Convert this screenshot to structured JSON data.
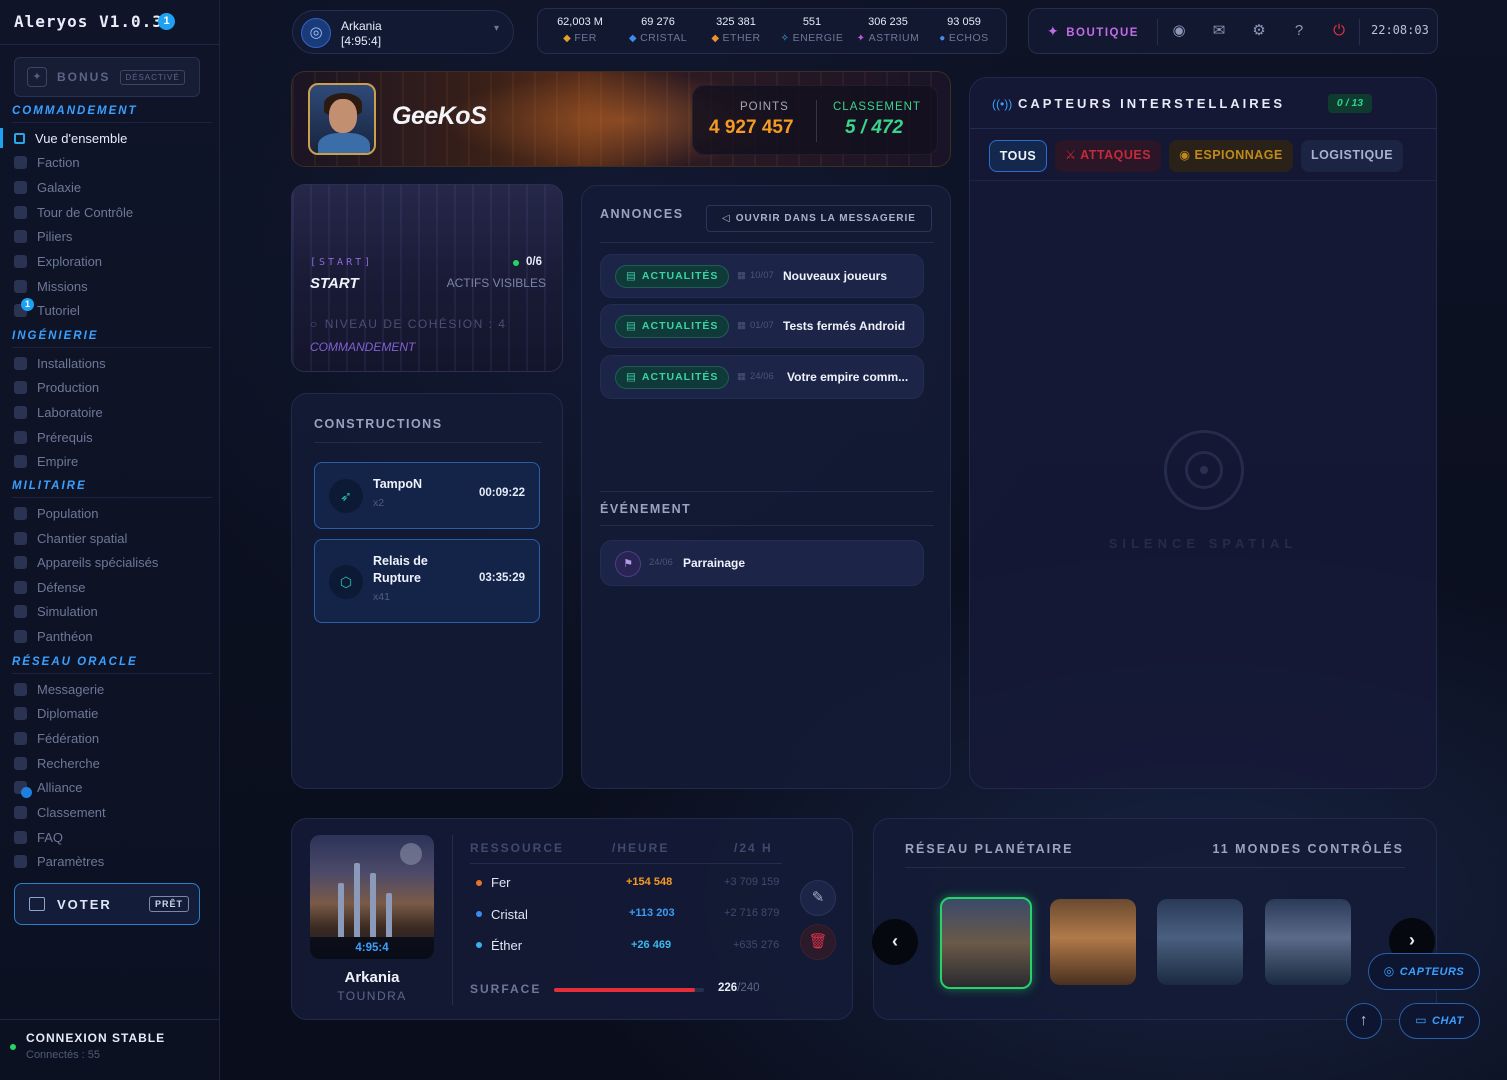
{
  "app": {
    "title": "Aleryos V1.0.36",
    "badge": "1"
  },
  "bonus": {
    "label": "BONUS",
    "status": "DÉSACTIVÉ"
  },
  "sidebar": {
    "sections": [
      {
        "title": "COMMANDEMENT"
      },
      {
        "title": "INGÉNIERIE"
      },
      {
        "title": "MILITAIRE"
      },
      {
        "title": "RÉSEAU ORACLE"
      }
    ],
    "items": [
      {
        "label": "Vue d'ensemble"
      },
      {
        "label": "Faction"
      },
      {
        "label": "Galaxie"
      },
      {
        "label": "Tour de Contrôle"
      },
      {
        "label": "Piliers"
      },
      {
        "label": "Exploration"
      },
      {
        "label": "Missions"
      },
      {
        "label": "Tutoriel"
      },
      {
        "label": "Installations"
      },
      {
        "label": "Production"
      },
      {
        "label": "Laboratoire"
      },
      {
        "label": "Prérequis"
      },
      {
        "label": "Empire"
      },
      {
        "label": "Population"
      },
      {
        "label": "Chantier spatial"
      },
      {
        "label": "Appareils spécialisés"
      },
      {
        "label": "Défense"
      },
      {
        "label": "Simulation"
      },
      {
        "label": "Panthéon"
      },
      {
        "label": "Messagerie"
      },
      {
        "label": "Diplomatie"
      },
      {
        "label": "Fédération"
      },
      {
        "label": "Recherche"
      },
      {
        "label": "Alliance"
      },
      {
        "label": "Classement"
      },
      {
        "label": "FAQ"
      },
      {
        "label": "Paramètres"
      }
    ],
    "tutoriel_badge": "1",
    "vote": {
      "label": "VOTER",
      "status": "PRÊT"
    },
    "connection": {
      "title": "CONNEXION STABLE",
      "sub": "Connectés : 55"
    }
  },
  "planet_selector": {
    "name": "Arkania",
    "coords": "[4:95:4]"
  },
  "resources": [
    {
      "value": "62,003 M",
      "label": "FER",
      "icon": "iron-icon",
      "color": "#e3a02a"
    },
    {
      "value": "69 276",
      "label": "CRISTAL",
      "icon": "crystal-icon",
      "color": "#3a8cf0"
    },
    {
      "value": "325 381",
      "label": "ETHER",
      "icon": "ether-icon",
      "color": "#e8942a"
    },
    {
      "value": "551",
      "label": "ENERGIE",
      "icon": "energy-icon",
      "color": "#3ab0f0"
    },
    {
      "value": "306 235",
      "label": "ASTRIUM",
      "icon": "astrium-icon",
      "color": "#c05ad8"
    },
    {
      "value": "93 059",
      "label": "ECHOS",
      "icon": "echos-icon",
      "color": "#4a8ae8"
    }
  ],
  "topbar": {
    "shop_label": "BOUTIQUE",
    "clock": "22:08:03"
  },
  "profile": {
    "username": "GeeKoS",
    "points_label": "POINTS",
    "points": "4 927 457",
    "rank_label": "CLASSEMENT",
    "rank": "5 / 472"
  },
  "start_card": {
    "tag": "[START]",
    "title": "START",
    "progress": "0/6",
    "actifs": "ACTIFS VISIBLES",
    "level": "NIVEAU DE COHÉSION : 4",
    "category": "COMMANDEMENT"
  },
  "constructions": {
    "title": "CONSTRUCTIONS",
    "jobs": [
      {
        "name": "TampoN",
        "qty": "x2",
        "time": "00:09:22",
        "icon": "rocket-icon"
      },
      {
        "name": "Relais de Rupture",
        "qty": "x41",
        "time": "03:35:29",
        "icon": "shield-icon"
      }
    ]
  },
  "annonces": {
    "title": "ANNONCES",
    "open_label": "OUVRIR DANS LA MESSAGERIE",
    "items": [
      {
        "tag": "ACTUALITÉS",
        "date": "10/07",
        "text": "Nouveaux joueurs"
      },
      {
        "tag": "ACTUALITÉS",
        "date": "01/07",
        "text": "Tests fermés Android"
      },
      {
        "tag": "ACTUALITÉS",
        "date": "24/06",
        "text": "Votre empire comm..."
      }
    ],
    "event_title": "ÉVÉNEMENT",
    "event": {
      "date": "24/06",
      "text": "Parrainage"
    }
  },
  "capteurs": {
    "title": "CAPTEURS INTERSTELLAIRES",
    "count": "0 / 13",
    "tabs": [
      {
        "label": "TOUS"
      },
      {
        "label": "ATTAQUES"
      },
      {
        "label": "ESPIONNAGE"
      },
      {
        "label": "LOGISTIQUE"
      }
    ],
    "empty_label": "SILENCE SPATIAL"
  },
  "planet_panel": {
    "coords": "4:95:4",
    "name": "Arkania",
    "type": "TOUNDRA",
    "headers": [
      "RESSOURCE",
      "/HEURE",
      "/24 H"
    ],
    "rows": [
      {
        "name": "Fer",
        "hour": "+154 548",
        "day": "+3 709 159",
        "color": "#e8742a",
        "hour_color": "#f59a22"
      },
      {
        "name": "Cristal",
        "hour": "+113 203",
        "day": "+2 716 879",
        "color": "#3a8cf0",
        "hour_color": "#3a9cf5"
      },
      {
        "name": "Éther",
        "hour": "+26 469",
        "day": "+635 276",
        "color": "#3ab0f0",
        "hour_color": "#3ab8f0"
      }
    ],
    "surface_label": "SURFACE",
    "surface_used": "226",
    "surface_total": "/240",
    "surface_fraction": 0.94
  },
  "network": {
    "title": "RÉSEAU PLANÉTAIRE",
    "count": "11 MONDES CONTRÔLÉS"
  },
  "fab": {
    "capteurs": "CAPTEURS",
    "chat": "CHAT"
  }
}
